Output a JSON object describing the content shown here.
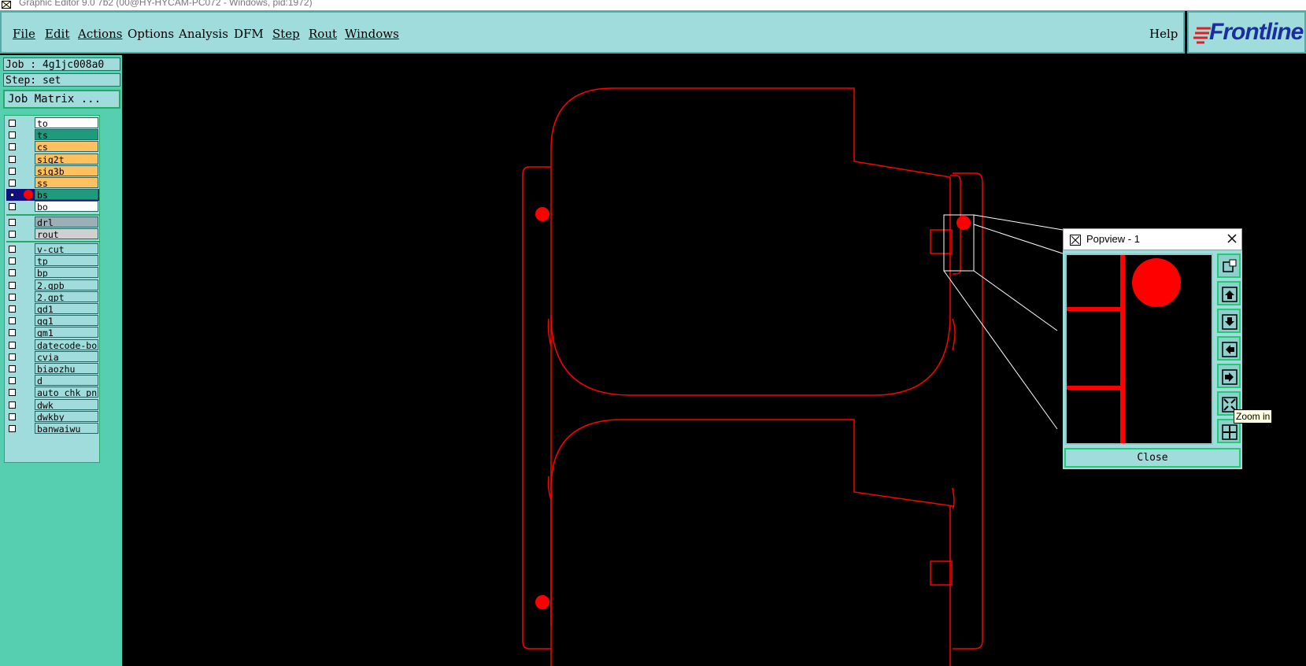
{
  "window": {
    "title": "Graphic Editor 9.0 7b2 (00@HY-HYCAM-PC072 - Windows, pid:1972)"
  },
  "menu": {
    "file": "File",
    "edit": "Edit",
    "actions": "Actions",
    "options": "Options",
    "analysis": "Analysis",
    "dfm": "DFM",
    "step": "Step",
    "rout": "Rout",
    "windows": "Windows",
    "help": "Help"
  },
  "brand": {
    "logo_text": "Frontline",
    "logo_color": "#1a2ea0"
  },
  "job": {
    "job_label": "Job : 4g1jc008a0",
    "step_label": "Step: set",
    "matrix_button": "Job Matrix ..."
  },
  "layers": {
    "group1": [
      {
        "name": "to",
        "color": "#ffffff",
        "selected": false
      },
      {
        "name": "ts",
        "color": "#1f9a7a",
        "selected": false
      },
      {
        "name": "cs",
        "color": "#ffc060",
        "selected": false
      },
      {
        "name": "sig2t",
        "color": "#ffc060",
        "selected": false
      },
      {
        "name": "sig3b",
        "color": "#ffc060",
        "selected": false
      },
      {
        "name": "ss",
        "color": "#ffc060",
        "selected": false
      },
      {
        "name": "bs",
        "color": "#1f9a7a",
        "selected": true
      },
      {
        "name": "bo",
        "color": "#ffffff",
        "selected": false
      }
    ],
    "group2": [
      {
        "name": "drl",
        "color": "#9ab0b4",
        "selected": false
      },
      {
        "name": "rout",
        "color": "#d0d0d0",
        "selected": false
      }
    ],
    "group3": [
      {
        "name": "v-cut"
      },
      {
        "name": "tp"
      },
      {
        "name": "bp"
      },
      {
        "name": "2.gpb"
      },
      {
        "name": "2.gpt"
      },
      {
        "name": "gd1"
      },
      {
        "name": "gg1"
      },
      {
        "name": "gm1"
      },
      {
        "name": "datecode-bo"
      },
      {
        "name": "cvia"
      },
      {
        "name": "biaozhu"
      },
      {
        "name": "d"
      },
      {
        "name": "auto_chk_pn"
      },
      {
        "name": "dwk"
      },
      {
        "name": "dwkby"
      },
      {
        "name": "banwaiwu"
      }
    ],
    "group3_color": "#a0dcdc"
  },
  "popview": {
    "title": "Popview - 1",
    "close_label": "Close",
    "tooltip": "Zoom in",
    "buttons": [
      "zoom-fit-icon",
      "pan-up-icon",
      "pan-down-icon",
      "pan-left-icon",
      "pan-right-icon",
      "zoom-in-icon",
      "zoom-out-icon"
    ]
  },
  "colors": {
    "panel": "#a0dcdc",
    "side": "#55cfb0",
    "drawing": "#ff0000",
    "canvas": "#000000"
  }
}
